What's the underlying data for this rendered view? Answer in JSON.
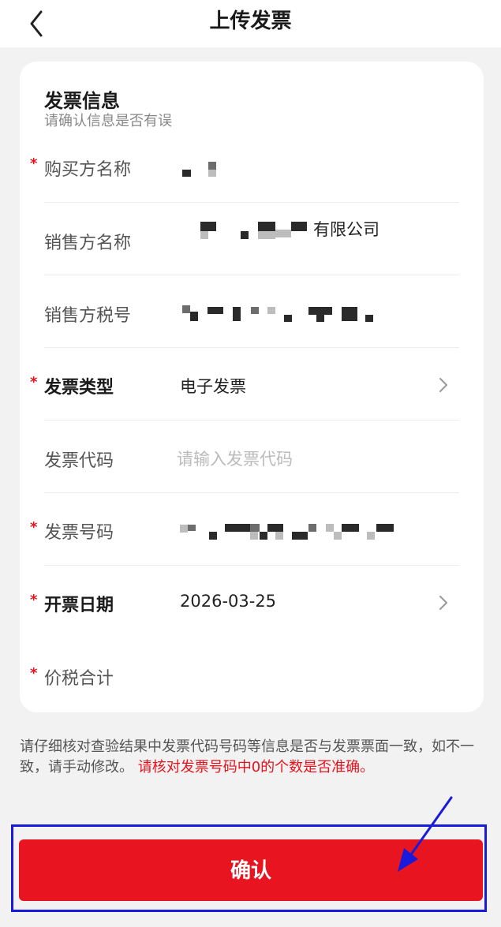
{
  "navbar": {
    "title": "上传发票",
    "back_icon": "chevron-left-icon"
  },
  "card": {
    "title": "发票信息",
    "subtitle": "请确认信息是否有误",
    "required_mark": "*",
    "fields": [
      {
        "label": "购买方名称",
        "required": true,
        "value": "",
        "redacted": true
      },
      {
        "label": "销售方名称",
        "required": false,
        "value": "有限公司",
        "redacted": true
      },
      {
        "label": "销售方税号",
        "required": false,
        "value": "",
        "redacted": true
      },
      {
        "label": "发票类型",
        "required": true,
        "value": "电子发票",
        "has_chevron": true
      },
      {
        "label": "发票代码",
        "required": false,
        "placeholder": "请输入发票代码"
      },
      {
        "label": "发票号码",
        "required": true,
        "value": "",
        "redacted": true
      },
      {
        "label": "开票日期",
        "required": true,
        "value": "2026-03-25",
        "has_chevron": true
      },
      {
        "label": "价税合计",
        "required": true,
        "value": ""
      }
    ]
  },
  "note": {
    "text": "请仔细核对查验结果中发票代码号码等信息是否与发票票面一致，如不一致，请手动修改。",
    "warning": "请核对发票号码中0的个数是否准确。"
  },
  "confirm_button": {
    "label": "确认"
  },
  "colors": {
    "accent_red": "#e8141f",
    "annotation_blue": "#1a1adb",
    "background": "#f2f2f2"
  }
}
